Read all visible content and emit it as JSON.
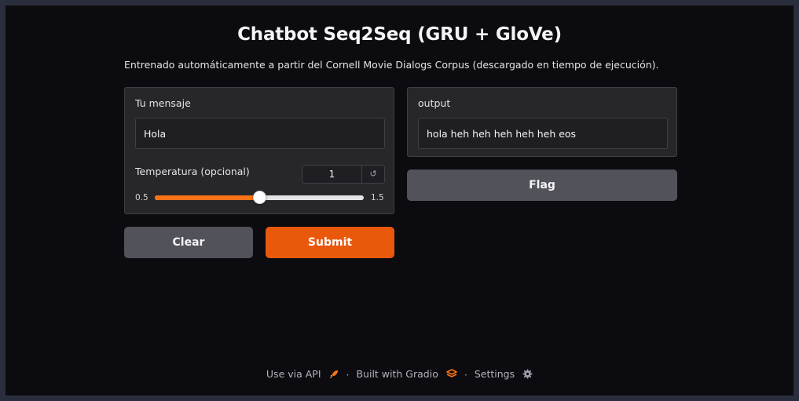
{
  "app": {
    "title": "Chatbot Seq2Seq (GRU + GloVe)",
    "description": "Entrenado automáticamente a partir del Cornell Movie Dialogs Corpus (descargado en tiempo de ejecución)."
  },
  "input_panel": {
    "message_label": "Tu mensaje",
    "message_value": "Hola",
    "temperature_label": "Temperatura (opcional)",
    "temperature_value": "1",
    "temperature_min": "0.5",
    "temperature_max": "1.5",
    "temperature_fraction": 0.5,
    "reset_icon": "reset-icon"
  },
  "output_panel": {
    "label": "output",
    "value": "hola heh heh heh heh heh eos"
  },
  "buttons": {
    "clear": "Clear",
    "submit": "Submit",
    "flag": "Flag"
  },
  "footer": {
    "api": "Use via API",
    "built": "Built with Gradio",
    "settings": "Settings",
    "separator": "·",
    "icons": [
      "rocket-icon",
      "gradio-logo-icon",
      "gear-icon"
    ]
  },
  "colors": {
    "accent": "#ea580c",
    "background": "#0c0b0f",
    "panel": "#27272a",
    "secondary_button": "#52525b"
  }
}
